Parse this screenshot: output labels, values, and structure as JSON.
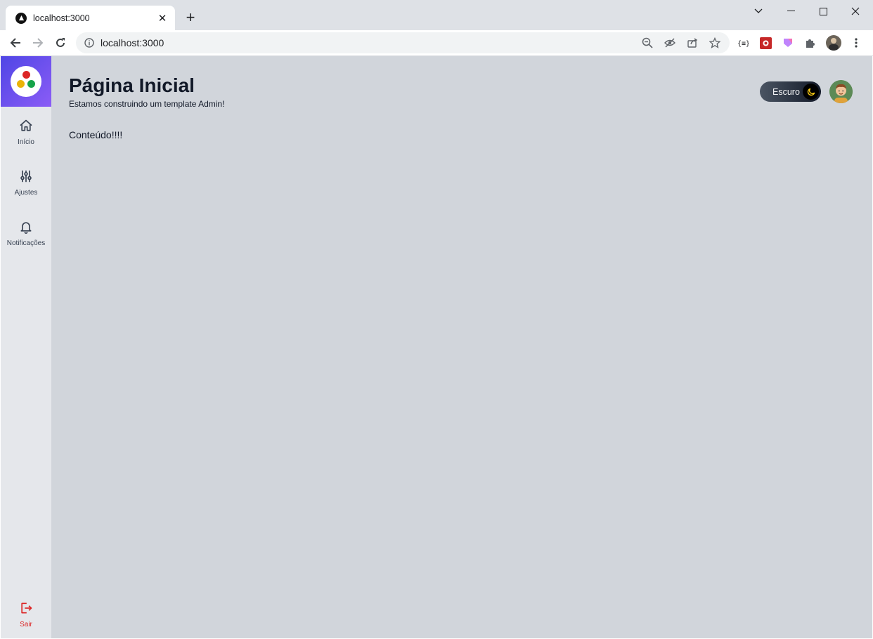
{
  "browser": {
    "tab_title": "localhost:3000",
    "new_tab": "+",
    "url": "localhost:3000"
  },
  "sidebar": {
    "logo_colors": [
      "#dc2626",
      "#eab308",
      "#16a34a"
    ],
    "items": [
      {
        "label": "Início",
        "icon": "home-icon"
      },
      {
        "label": "Ajustes",
        "icon": "sliders-icon"
      },
      {
        "label": "Notificações",
        "icon": "bell-icon"
      }
    ],
    "logout": {
      "label": "Sair",
      "icon": "logout-icon"
    }
  },
  "header": {
    "title": "Página Inicial",
    "subtitle": "Estamos construindo um template Admin!",
    "theme_toggle_label": "Escuro"
  },
  "main": {
    "content": "Conteúdo!!!!"
  },
  "colors": {
    "accent_gradient_start": "#4f46e5",
    "accent_gradient_end": "#8b5cf6",
    "logout": "#dc2626",
    "main_bg": "#d1d5db",
    "sidebar_bg": "#e5e7eb"
  }
}
